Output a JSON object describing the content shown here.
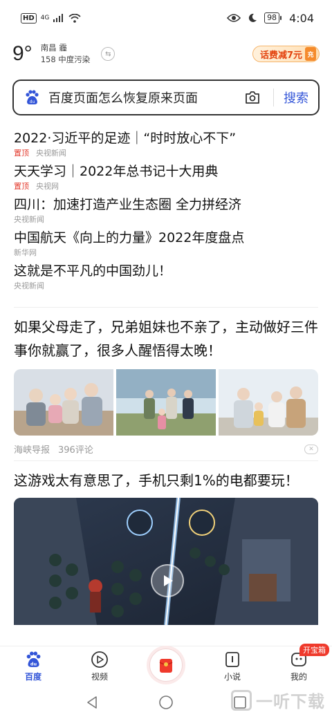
{
  "status_bar": {
    "hd": "HD",
    "network": "4G",
    "battery": "98",
    "time": "4:04"
  },
  "weather": {
    "temperature": "9°",
    "location": "南昌 霾",
    "aqi": "158 中度污染"
  },
  "promo": {
    "label": "话费减7元",
    "icon_text": "充"
  },
  "search": {
    "query": "百度页面怎么恢复原来页面",
    "button_label": "搜索"
  },
  "hot_news": [
    {
      "title": "2022·习近平的足迹｜“时时放心不下”",
      "tag": "置顶",
      "source": "央视新闻"
    },
    {
      "title": "天天学习｜2022年总书记十大用典",
      "tag": "置顶",
      "source": "央视网"
    },
    {
      "title": "四川：加速打造产业生态圈 全力拼经济",
      "tag": "",
      "source": "央视新闻"
    },
    {
      "title": "中国航天《向上的力量》2022年度盘点",
      "tag": "",
      "source": "新华网"
    },
    {
      "title": "这就是不平凡的中国劲儿！",
      "tag": "",
      "source": "央视新闻"
    }
  ],
  "feed": {
    "article1": {
      "title": "如果父母走了，兄弟姐妹也不亲了，主动做好三件事你就赢了，很多人醒悟得太晚！",
      "source": "海峡导报",
      "comments": "396评论"
    },
    "article2": {
      "title": "这游戏太有意思了，手机只剩1%的电都要玩！"
    }
  },
  "tabs": [
    {
      "label": "百度",
      "icon": "baidu-paw-icon",
      "active": true
    },
    {
      "label": "视频",
      "icon": "video-play-icon"
    },
    {
      "label": "",
      "icon": "red-envelope-icon"
    },
    {
      "label": "小说",
      "icon": "book-icon"
    },
    {
      "label": "我的",
      "icon": "profile-face-icon",
      "badge": "开宝箱"
    }
  ],
  "watermark": "一听下载",
  "colors": {
    "accent": "#3355d8",
    "hot_tag": "#e33b2e",
    "promo": "#e3420e"
  }
}
